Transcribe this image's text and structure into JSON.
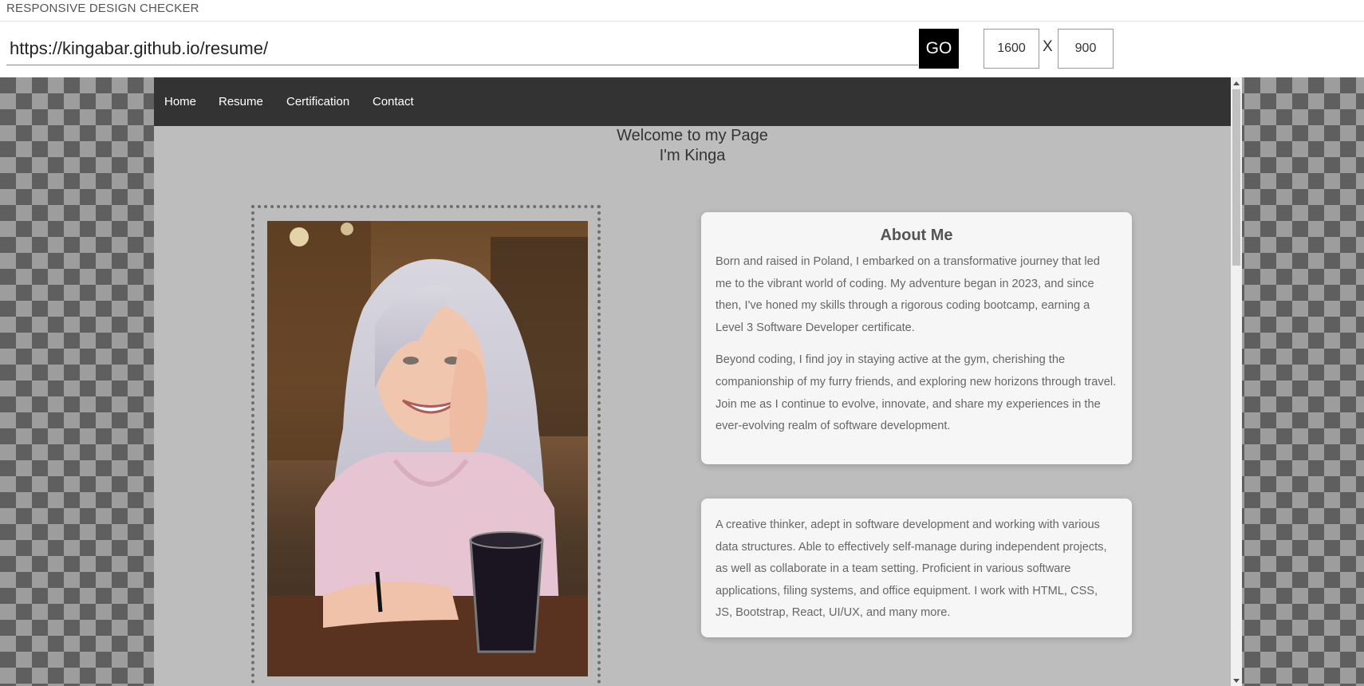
{
  "checker": {
    "title": "RESPONSIVE DESIGN CHECKER",
    "url_value": "https://kingabar.github.io/resume/",
    "go_label": "GO",
    "width_value": "1600",
    "separator": "X",
    "height_value": "900"
  },
  "site": {
    "nav": {
      "home": "Home",
      "resume": "Resume",
      "certification": "Certification",
      "contact": "Contact"
    },
    "welcome_line1": "Welcome to my Page",
    "welcome_line2": "I'm Kinga",
    "about": {
      "title": "About Me",
      "p1": "Born and raised in Poland, I embarked on a transformative journey that led me to the vibrant world of coding. My adventure began in 2023, and since then, I've honed my skills through a rigorous coding bootcamp, earning a Level 3 Software Developer certificate.",
      "p2": "Beyond coding, I find joy in staying active at the gym, cherishing the companionship of my furry friends, and exploring new horizons through travel. Join me as I continue to evolve, innovate, and share my experiences in the ever-evolving realm of software development."
    },
    "summary": {
      "p1": "A creative thinker, adept in software development and working with various data structures. Able to effectively self-manage during independent projects, as well as collaborate in a team setting. Proficient in various software applications, filing systems, and office equipment. I work with HTML, CSS, JS, Bootstrap, React, UI/UX, and many more."
    }
  },
  "colors": {
    "nav_background": "#333333",
    "site_background": "#bdbdbd",
    "card_background": "#f6f6f6",
    "go_button": "#000000"
  }
}
